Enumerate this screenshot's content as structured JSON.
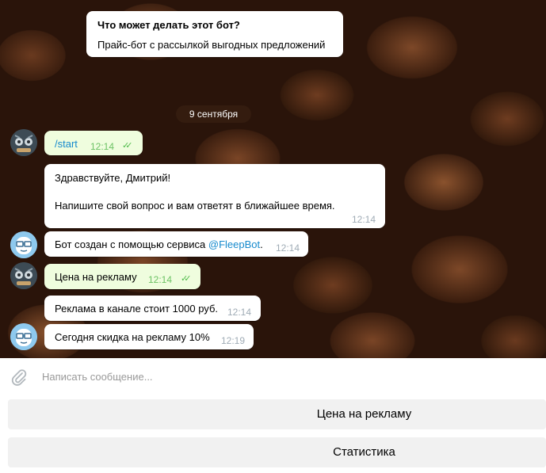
{
  "intro": {
    "title": "Что может делать этот бот?",
    "text": "Прайс-бот с рассылкой выгодных предложений"
  },
  "date_separator": "9 сентября",
  "messages": [
    {
      "direction": "out",
      "text": "/start",
      "time": "12:14",
      "ticks": "✓✓"
    },
    {
      "direction": "in",
      "line1": "Здравствуйте, Дмитрий!",
      "line2": "Напишите свой вопрос и вам ответят в ближайшее время.",
      "time": "12:14"
    },
    {
      "direction": "in",
      "text": "Бот создан с помощью сервиса ",
      "link": "@FleepBot",
      "suffix": ".",
      "time": "12:14"
    },
    {
      "direction": "out",
      "text": "Цена на рекламу",
      "time": "12:14",
      "ticks": "✓✓"
    },
    {
      "direction": "in",
      "text": "Реклама в канале стоит 1000 руб.",
      "time": "12:14"
    },
    {
      "direction": "in",
      "text": "Сегодня скидка на рекламу 10%",
      "time": "12:19"
    }
  ],
  "input": {
    "placeholder": "Написать сообщение..."
  },
  "keyboard": [
    {
      "label": "Цена на рекламу"
    },
    {
      "label": "Статистика"
    }
  ],
  "icons": {
    "attach": "paperclip-icon",
    "read": "double-check-icon"
  },
  "colors": {
    "bubble_in": "#ffffff",
    "bubble_out": "#effdde",
    "link": "#168acd",
    "check": "#4fbb4a"
  }
}
